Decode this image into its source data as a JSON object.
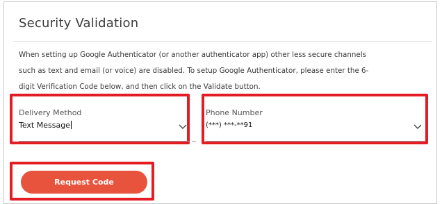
{
  "form": {
    "title": "Security Validation",
    "description_lines": [
      "When setting up Google Authenticator (or another authenticator app) other less secure channels",
      "such as text and email (or voice) are disabled. To setup Google Authenticator, please enter the 6-",
      "digit Verification Code below, and then click on the Validate button."
    ],
    "delivery_method": {
      "label": "Delivery Method",
      "value": "Text Message"
    },
    "phone_number": {
      "label": "Phone Number",
      "value": "(***) ***-**91"
    },
    "request_button_label": "Request Code"
  },
  "colors": {
    "highlight": "#e41d24",
    "button": "#e7533d"
  }
}
